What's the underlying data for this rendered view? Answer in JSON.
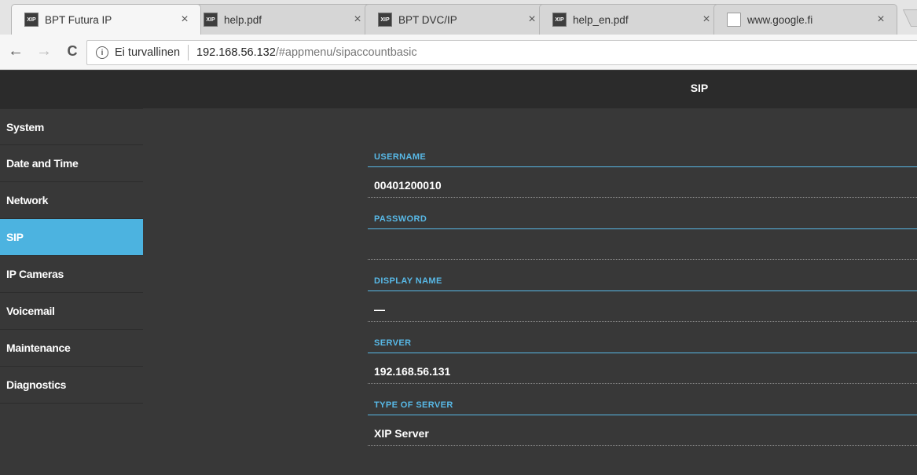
{
  "browser": {
    "tabs": [
      {
        "title": "BPT Futura IP",
        "icon": "xip-favicon",
        "active": true
      },
      {
        "title": "help.pdf",
        "icon": "xip-favicon",
        "active": false
      },
      {
        "title": "BPT DVC/IP",
        "icon": "xip-favicon",
        "active": false
      },
      {
        "title": "help_en.pdf",
        "icon": "xip-favicon",
        "active": false
      },
      {
        "title": "www.google.fi",
        "icon": "page-icon",
        "active": false
      }
    ],
    "close_glyph": "×",
    "nav": {
      "back": "←",
      "forward": "→",
      "reload": "C"
    },
    "security_label": "Ei turvallinen",
    "url_host": "192.168.56.132",
    "url_rest": "/#appmenu/sipaccountbasic"
  },
  "app": {
    "title": "SIP",
    "sidebar": [
      {
        "label": "System"
      },
      {
        "label": "Date and Time"
      },
      {
        "label": "Network"
      },
      {
        "label": "SIP",
        "active": true
      },
      {
        "label": "IP Cameras"
      },
      {
        "label": "Voicemail"
      },
      {
        "label": "Maintenance"
      },
      {
        "label": "Diagnostics"
      }
    ],
    "fields": [
      {
        "label": "USERNAME",
        "value": "00401200010"
      },
      {
        "label": "PASSWORD",
        "value": ""
      },
      {
        "label": "DISPLAY NAME",
        "value": "—"
      },
      {
        "label": "SERVER",
        "value": "192.168.56.131"
      },
      {
        "label": "TYPE OF SERVER",
        "value": "XIP Server"
      }
    ],
    "colors": {
      "accent": "#4cb3e0",
      "background": "#383838",
      "header": "#2b2b2b"
    }
  }
}
